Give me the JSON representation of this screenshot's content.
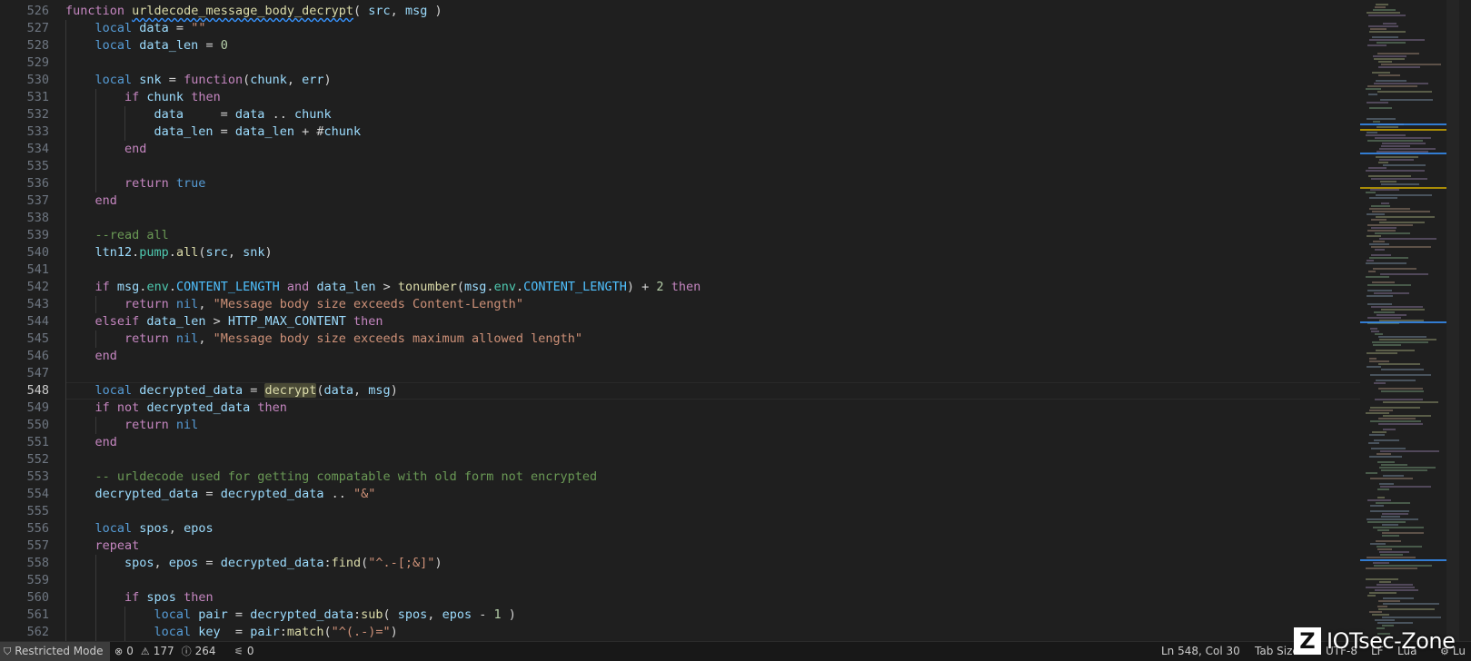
{
  "editor": {
    "line_numbers": [
      "526",
      "527",
      "528",
      "529",
      "530",
      "531",
      "532",
      "533",
      "534",
      "535",
      "536",
      "537",
      "538",
      "539",
      "540",
      "541",
      "542",
      "543",
      "544",
      "545",
      "546",
      "547",
      "548",
      "549",
      "550",
      "551",
      "552",
      "553",
      "554",
      "555",
      "556",
      "557",
      "558",
      "559",
      "560",
      "561",
      "562"
    ],
    "active_line": "548",
    "lines": [
      {
        "indent": 0,
        "tokens": [
          [
            "kw",
            "function"
          ],
          [
            "plain",
            " "
          ],
          [
            "fn sq",
            "urldecode_message_body_decrypt"
          ],
          [
            "plain",
            "( "
          ],
          [
            "ident",
            "src"
          ],
          [
            "plain",
            ", "
          ],
          [
            "ident",
            "msg"
          ],
          [
            "plain",
            " )"
          ]
        ]
      },
      {
        "indent": 1,
        "tokens": [
          [
            "fnk",
            "local"
          ],
          [
            "plain",
            " "
          ],
          [
            "ident",
            "data"
          ],
          [
            "plain",
            " = "
          ],
          [
            "str",
            "\"\""
          ]
        ]
      },
      {
        "indent": 1,
        "tokens": [
          [
            "fnk",
            "local"
          ],
          [
            "plain",
            " "
          ],
          [
            "ident",
            "data_len"
          ],
          [
            "plain",
            " = "
          ],
          [
            "num",
            "0"
          ]
        ]
      },
      {
        "indent": 1,
        "tokens": []
      },
      {
        "indent": 1,
        "tokens": [
          [
            "fnk",
            "local"
          ],
          [
            "plain",
            " "
          ],
          [
            "ident",
            "snk"
          ],
          [
            "plain",
            " = "
          ],
          [
            "kw",
            "function"
          ],
          [
            "plain",
            "("
          ],
          [
            "ident",
            "chunk"
          ],
          [
            "plain",
            ", "
          ],
          [
            "ident",
            "err"
          ],
          [
            "plain",
            ")"
          ]
        ]
      },
      {
        "indent": 2,
        "tokens": [
          [
            "kw",
            "if"
          ],
          [
            "plain",
            " "
          ],
          [
            "ident",
            "chunk"
          ],
          [
            "plain",
            " "
          ],
          [
            "kw",
            "then"
          ]
        ]
      },
      {
        "indent": 3,
        "tokens": [
          [
            "ident",
            "data"
          ],
          [
            "plain",
            "     = "
          ],
          [
            "ident",
            "data"
          ],
          [
            "plain",
            " .. "
          ],
          [
            "ident",
            "chunk"
          ]
        ]
      },
      {
        "indent": 3,
        "tokens": [
          [
            "ident",
            "data_len"
          ],
          [
            "plain",
            " = "
          ],
          [
            "ident",
            "data_len"
          ],
          [
            "plain",
            " + #"
          ],
          [
            "ident",
            "chunk"
          ]
        ]
      },
      {
        "indent": 2,
        "tokens": [
          [
            "kw",
            "end"
          ]
        ]
      },
      {
        "indent": 2,
        "tokens": []
      },
      {
        "indent": 2,
        "tokens": [
          [
            "kw",
            "return"
          ],
          [
            "plain",
            " "
          ],
          [
            "lang",
            "true"
          ]
        ]
      },
      {
        "indent": 1,
        "tokens": [
          [
            "kw",
            "end"
          ]
        ]
      },
      {
        "indent": 1,
        "tokens": []
      },
      {
        "indent": 1,
        "tokens": [
          [
            "cmt",
            "--read all"
          ]
        ]
      },
      {
        "indent": 1,
        "tokens": [
          [
            "ident",
            "ltn12"
          ],
          [
            "plain",
            "."
          ],
          [
            "prop",
            "pump"
          ],
          [
            "plain",
            "."
          ],
          [
            "fn",
            "all"
          ],
          [
            "plain",
            "("
          ],
          [
            "ident",
            "src"
          ],
          [
            "plain",
            ", "
          ],
          [
            "ident",
            "snk"
          ],
          [
            "plain",
            ")"
          ]
        ]
      },
      {
        "indent": 1,
        "tokens": []
      },
      {
        "indent": 1,
        "tokens": [
          [
            "kw",
            "if"
          ],
          [
            "plain",
            " "
          ],
          [
            "ident",
            "msg"
          ],
          [
            "plain",
            "."
          ],
          [
            "prop",
            "env"
          ],
          [
            "plain",
            "."
          ],
          [
            "const",
            "CONTENT_LENGTH"
          ],
          [
            "plain",
            " "
          ],
          [
            "kw",
            "and"
          ],
          [
            "plain",
            " "
          ],
          [
            "ident",
            "data_len"
          ],
          [
            "plain",
            " > "
          ],
          [
            "fn",
            "tonumber"
          ],
          [
            "plain",
            "("
          ],
          [
            "ident",
            "msg"
          ],
          [
            "plain",
            "."
          ],
          [
            "prop",
            "env"
          ],
          [
            "plain",
            "."
          ],
          [
            "const",
            "CONTENT_LENGTH"
          ],
          [
            "plain",
            ") + "
          ],
          [
            "num",
            "2"
          ],
          [
            "plain",
            " "
          ],
          [
            "kw",
            "then"
          ]
        ]
      },
      {
        "indent": 2,
        "tokens": [
          [
            "kw",
            "return"
          ],
          [
            "plain",
            " "
          ],
          [
            "lang",
            "nil"
          ],
          [
            "plain",
            ", "
          ],
          [
            "str",
            "\"Message body size exceeds Content-Length\""
          ]
        ]
      },
      {
        "indent": 1,
        "tokens": [
          [
            "kw",
            "elseif"
          ],
          [
            "plain",
            " "
          ],
          [
            "ident",
            "data_len"
          ],
          [
            "plain",
            " > "
          ],
          [
            "ident",
            "HTTP_MAX_CONTENT"
          ],
          [
            "plain",
            " "
          ],
          [
            "kw",
            "then"
          ]
        ]
      },
      {
        "indent": 2,
        "tokens": [
          [
            "kw",
            "return"
          ],
          [
            "plain",
            " "
          ],
          [
            "lang",
            "nil"
          ],
          [
            "plain",
            ", "
          ],
          [
            "str",
            "\"Message body size exceeds maximum allowed length\""
          ]
        ]
      },
      {
        "indent": 1,
        "tokens": [
          [
            "kw",
            "end"
          ]
        ]
      },
      {
        "indent": 1,
        "tokens": []
      },
      {
        "indent": 1,
        "tokens": [
          [
            "fnk",
            "local"
          ],
          [
            "plain",
            " "
          ],
          [
            "ident",
            "decrypted_data"
          ],
          [
            "plain",
            " = "
          ],
          [
            "fn hl",
            "decrypt"
          ],
          [
            "plain",
            "("
          ],
          [
            "ident",
            "data"
          ],
          [
            "plain",
            ", "
          ],
          [
            "ident",
            "msg"
          ],
          [
            "plain",
            ")"
          ]
        ]
      },
      {
        "indent": 1,
        "tokens": [
          [
            "kw",
            "if"
          ],
          [
            "plain",
            " "
          ],
          [
            "kw",
            "not"
          ],
          [
            "plain",
            " "
          ],
          [
            "ident",
            "decrypted_data"
          ],
          [
            "plain",
            " "
          ],
          [
            "kw",
            "then"
          ]
        ]
      },
      {
        "indent": 2,
        "tokens": [
          [
            "kw",
            "return"
          ],
          [
            "plain",
            " "
          ],
          [
            "lang",
            "nil"
          ]
        ]
      },
      {
        "indent": 1,
        "tokens": [
          [
            "kw",
            "end"
          ]
        ]
      },
      {
        "indent": 1,
        "tokens": []
      },
      {
        "indent": 1,
        "tokens": [
          [
            "cmt",
            "-- urldecode used for getting compatable with old form not encrypted"
          ]
        ]
      },
      {
        "indent": 1,
        "tokens": [
          [
            "ident",
            "decrypted_data"
          ],
          [
            "plain",
            " = "
          ],
          [
            "ident",
            "decrypted_data"
          ],
          [
            "plain",
            " .. "
          ],
          [
            "str",
            "\"&\""
          ]
        ]
      },
      {
        "indent": 1,
        "tokens": []
      },
      {
        "indent": 1,
        "tokens": [
          [
            "fnk",
            "local"
          ],
          [
            "plain",
            " "
          ],
          [
            "ident",
            "spos"
          ],
          [
            "plain",
            ", "
          ],
          [
            "ident",
            "epos"
          ]
        ]
      },
      {
        "indent": 1,
        "tokens": [
          [
            "kw",
            "repeat"
          ]
        ]
      },
      {
        "indent": 2,
        "tokens": [
          [
            "ident",
            "spos"
          ],
          [
            "plain",
            ", "
          ],
          [
            "ident",
            "epos"
          ],
          [
            "plain",
            " = "
          ],
          [
            "ident",
            "decrypted_data"
          ],
          [
            "plain",
            ":"
          ],
          [
            "fn",
            "find"
          ],
          [
            "plain",
            "("
          ],
          [
            "str",
            "\"^.-[;&]\""
          ],
          [
            "plain",
            ")"
          ]
        ]
      },
      {
        "indent": 2,
        "tokens": []
      },
      {
        "indent": 2,
        "tokens": [
          [
            "kw",
            "if"
          ],
          [
            "plain",
            " "
          ],
          [
            "ident",
            "spos"
          ],
          [
            "plain",
            " "
          ],
          [
            "kw",
            "then"
          ]
        ]
      },
      {
        "indent": 3,
        "tokens": [
          [
            "fnk",
            "local"
          ],
          [
            "plain",
            " "
          ],
          [
            "ident",
            "pair"
          ],
          [
            "plain",
            " = "
          ],
          [
            "ident",
            "decrypted_data"
          ],
          [
            "plain",
            ":"
          ],
          [
            "fn",
            "sub"
          ],
          [
            "plain",
            "( "
          ],
          [
            "ident",
            "spos"
          ],
          [
            "plain",
            ", "
          ],
          [
            "ident",
            "epos"
          ],
          [
            "plain",
            " - "
          ],
          [
            "num",
            "1"
          ],
          [
            "plain",
            " )"
          ]
        ]
      },
      {
        "indent": 3,
        "tokens": [
          [
            "fnk",
            "local"
          ],
          [
            "plain",
            " "
          ],
          [
            "ident",
            "key"
          ],
          [
            "plain",
            "  = "
          ],
          [
            "ident",
            "pair"
          ],
          [
            "plain",
            ":"
          ],
          [
            "fn",
            "match"
          ],
          [
            "plain",
            "("
          ],
          [
            "str",
            "\"^(.-)=\""
          ],
          [
            "plain",
            ")"
          ]
        ]
      }
    ]
  },
  "statusbar": {
    "restricted_mode": "Restricted Mode",
    "errors": "0",
    "warnings": "177",
    "infos": "264",
    "ports": "0",
    "cursor": "Ln 548, Col 30",
    "tab_size": "Tab Size: 4",
    "encoding": "UTF-8",
    "eol": "LF",
    "language": "Lua",
    "extra": "Lu"
  },
  "watermark": {
    "logo_letter": "Z",
    "text": "IOTsec-Zone"
  },
  "colors": {
    "background": "#1f1f1f",
    "keyword": "#c586c0",
    "function": "#dcdcaa",
    "string": "#ce9178",
    "comment": "#6a9955"
  }
}
